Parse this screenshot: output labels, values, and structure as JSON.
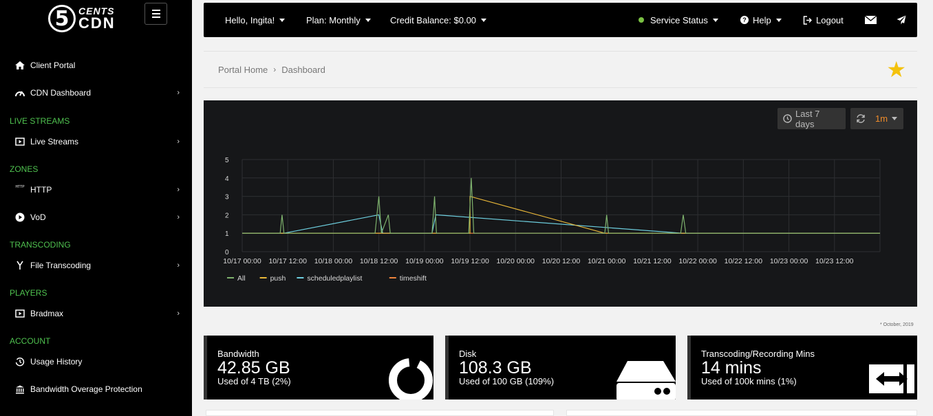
{
  "brand": {
    "cents": "CENTS",
    "cdn": "CDN",
    "five": "5"
  },
  "sidebar": {
    "items": [
      {
        "label": "Client Portal",
        "icon": "home-icon"
      },
      {
        "label": "CDN Dashboard",
        "icon": "gauge-icon"
      },
      {
        "section": "LIVE STREAMS"
      },
      {
        "label": "Live Streams",
        "icon": "play-square-icon"
      },
      {
        "section": "ZONES"
      },
      {
        "label": "HTTP",
        "icon": "http-icon"
      },
      {
        "label": "VoD",
        "icon": "play-circle-icon"
      },
      {
        "section": "TRANSCODING"
      },
      {
        "label": "File Transcoding",
        "icon": "merge-icon"
      },
      {
        "section": "PLAYERS"
      },
      {
        "label": "Bradmax",
        "icon": "play-square-icon"
      },
      {
        "section": "ACCOUNT"
      },
      {
        "label": "Usage History",
        "icon": "history-icon"
      },
      {
        "label": "Bandwidth Overage Protection",
        "icon": "bank-icon"
      }
    ],
    "http_icon_text": "HTTP"
  },
  "topbar": {
    "greeting": "Hello, Ingita!",
    "plan": "Plan: Monthly",
    "credit": "Credit Balance: $0.00",
    "status": "Service Status",
    "help": "Help",
    "logout": "Logout"
  },
  "breadcrumb": {
    "home": "Portal Home",
    "current": "Dashboard"
  },
  "time_controls": {
    "range": "Last 7 days",
    "refresh": "1m"
  },
  "colors": {
    "all": "#7eb26d",
    "push": "#eab839",
    "scheduledplaylist": "#6ed0e0",
    "timeshift": "#ef843c",
    "accent": "#4fc14f"
  },
  "chart_data": {
    "type": "line",
    "x": [
      "10/17 00:00",
      "10/17 12:00",
      "10/18 00:00",
      "10/18 12:00",
      "10/19 00:00",
      "10/19 12:00",
      "10/20 00:00",
      "10/20 12:00",
      "10/21 00:00",
      "10/21 12:00",
      "10/22 00:00",
      "10/22 12:00",
      "10/23 00:00",
      "10/23 12:00"
    ],
    "y_ticks": [
      0,
      1,
      2,
      3,
      4,
      5
    ],
    "xlim": [
      "10/17 00:00",
      "10/24 00:00"
    ],
    "ylim": [
      0,
      5
    ],
    "legend_position": "bottom-left",
    "grid": true,
    "series": [
      {
        "name": "All",
        "points": [
          [
            "10/17 00:00",
            1
          ],
          [
            "10/17 10:00",
            1
          ],
          [
            "10/17 10:30",
            2
          ],
          [
            "10/17 11:00",
            1
          ],
          [
            "10/18 11:00",
            1
          ],
          [
            "10/18 12:00",
            3
          ],
          [
            "10/18 12:40",
            1
          ],
          [
            "10/18 14:30",
            2
          ],
          [
            "10/18 15:00",
            1
          ],
          [
            "10/19 02:00",
            1
          ],
          [
            "10/19 02:40",
            3
          ],
          [
            "10/19 03:10",
            1
          ],
          [
            "10/19 11:40",
            1
          ],
          [
            "10/19 12:20",
            4
          ],
          [
            "10/19 13:00",
            1
          ],
          [
            "10/20 23:30",
            1
          ],
          [
            "10/21 00:00",
            2
          ],
          [
            "10/21 00:30",
            1
          ],
          [
            "10/21 19:30",
            1
          ],
          [
            "10/21 20:10",
            2
          ],
          [
            "10/21 20:50",
            1
          ],
          [
            "10/23 23:59",
            1
          ]
        ]
      },
      {
        "name": "push",
        "points": [
          [
            "10/17 00:00",
            1
          ],
          [
            "10/19 12:00",
            1
          ],
          [
            "10/19 12:00",
            3
          ],
          [
            "10/20 23:30",
            1
          ],
          [
            "10/23 23:59",
            1
          ]
        ]
      },
      {
        "name": "scheduledplaylist",
        "points": [
          [
            "10/17 00:00",
            1
          ],
          [
            "10/17 11:00",
            1
          ],
          [
            "10/18 12:00",
            2
          ],
          [
            "10/18 13:00",
            1
          ],
          [
            "10/19 02:00",
            1
          ],
          [
            "10/19 03:00",
            2
          ],
          [
            "10/21 20:00",
            1
          ],
          [
            "10/23 23:59",
            1
          ]
        ]
      },
      {
        "name": "timeshift",
        "points": [
          [
            "10/17 00:00",
            1
          ],
          [
            "10/23 23:59",
            1
          ]
        ]
      }
    ]
  },
  "footnote": "* October, 2019",
  "cards": [
    {
      "title": "Bandwidth",
      "value": "42.85 GB",
      "sub": "Used of 4 TB (2%)",
      "icon": "pie-chart-icon"
    },
    {
      "title": "Disk",
      "value": "108.3 GB",
      "sub": "Used of 100 GB (109%)",
      "icon": "hard-drive-icon"
    },
    {
      "title": "Transcoding/Recording Mins",
      "value": "14 mins",
      "sub": "Used of 100k mins (1%)",
      "icon": "transcode-arrows-icon"
    }
  ]
}
